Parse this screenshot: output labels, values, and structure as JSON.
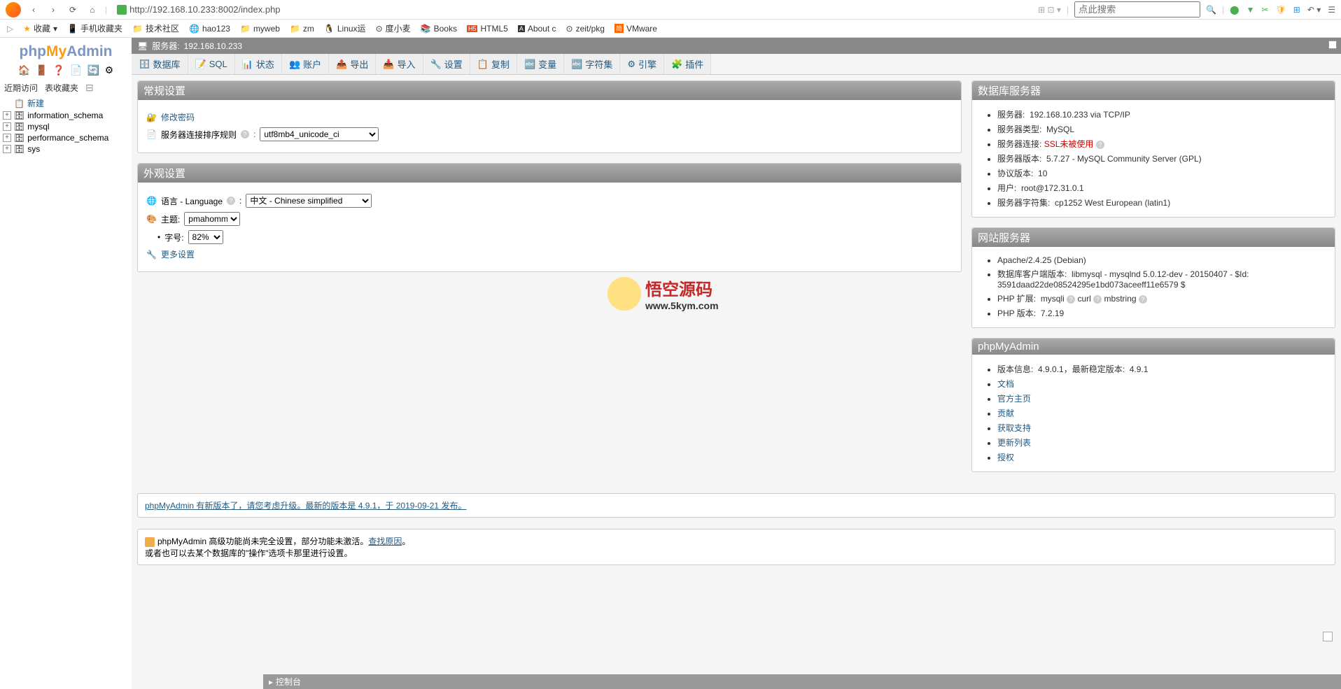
{
  "browser": {
    "url": "http://192.168.10.233:8002/index.php",
    "search_placeholder": "点此搜索"
  },
  "bookmarks": {
    "items": [
      {
        "label": "收藏"
      },
      {
        "label": "手机收藏夹"
      },
      {
        "label": "技术社区"
      },
      {
        "label": "hao123"
      },
      {
        "label": "myweb"
      },
      {
        "label": "zm"
      },
      {
        "label": "Linux运"
      },
      {
        "label": "度小麦"
      },
      {
        "label": "Books"
      },
      {
        "label": "HTML5"
      },
      {
        "label": "About c"
      },
      {
        "label": "zeit/pkg"
      },
      {
        "label": "VMware"
      }
    ]
  },
  "logo": {
    "php": "php",
    "my": "My",
    "admin": "Admin"
  },
  "sidebar": {
    "recent": "近期访问",
    "favorites": "表收藏夹",
    "new_link": "新建",
    "databases": [
      {
        "name": "information_schema"
      },
      {
        "name": "mysql"
      },
      {
        "name": "performance_schema"
      },
      {
        "name": "sys"
      }
    ]
  },
  "server_bar": {
    "label": "服务器:",
    "value": "192.168.10.233"
  },
  "tabs": [
    {
      "label": "数据库"
    },
    {
      "label": "SQL"
    },
    {
      "label": "状态"
    },
    {
      "label": "账户"
    },
    {
      "label": "导出"
    },
    {
      "label": "导入"
    },
    {
      "label": "设置"
    },
    {
      "label": "复制"
    },
    {
      "label": "变量"
    },
    {
      "label": "字符集"
    },
    {
      "label": "引擎"
    },
    {
      "label": "插件"
    }
  ],
  "general_settings": {
    "title": "常规设置",
    "change_password": "修改密码",
    "collation_label": "服务器连接排序规则",
    "collation_value": "utf8mb4_unicode_ci"
  },
  "appearance": {
    "title": "外观设置",
    "language_label": "语言 - Language",
    "language_value": "中文 - Chinese simplified",
    "theme_label": "主题:",
    "theme_value": "pmahomme",
    "fontsize_label": "字号:",
    "fontsize_value": "82%",
    "more_settings": "更多设置"
  },
  "db_server": {
    "title": "数据库服务器",
    "items": {
      "server_label": "服务器:",
      "server_val": "192.168.10.233 via TCP/IP",
      "type_label": "服务器类型:",
      "type_val": "MySQL",
      "conn_label": "服务器连接:",
      "conn_val": "SSL未被使用",
      "version_label": "服务器版本:",
      "version_val": "5.7.27 - MySQL Community Server (GPL)",
      "protocol_label": "协议版本:",
      "protocol_val": "10",
      "user_label": "用户:",
      "user_val": "root@172.31.0.1",
      "charset_label": "服务器字符集:",
      "charset_val": "cp1252 West European (latin1)"
    }
  },
  "web_server": {
    "title": "网站服务器",
    "apache": "Apache/2.4.25 (Debian)",
    "client_label": "数据库客户端版本:",
    "client_val": "libmysql - mysqlnd 5.0.12-dev - 20150407 - $Id: 3591daad22de08524295e1bd073aceeff11e6579 $",
    "php_ext_label": "PHP 扩展:",
    "php_ext1": "mysqli",
    "php_ext2": "curl",
    "php_ext3": "mbstring",
    "php_ver_label": "PHP 版本:",
    "php_ver_val": "7.2.19"
  },
  "pma": {
    "title": "phpMyAdmin",
    "version_label": "版本信息:",
    "version_val": "4.9.0.1，最新稳定版本:",
    "latest": "4.9.1",
    "links": {
      "docs": "文档",
      "home": "官方主页",
      "contribute": "贡献",
      "support": "获取支持",
      "changelog": "更新列表",
      "license": "授权"
    }
  },
  "notice1": "phpMyAdmin 有新版本了，请您考虑升级。最新的版本是 4.9.1，于 2019-09-21 发布。",
  "notice2": {
    "text1": "phpMyAdmin 高级功能尚未完全设置，部分功能未激活。",
    "link": "查找原因",
    "text2": "。",
    "text3": "或者也可以去某个数据库的\"操作\"选项卡那里进行设置。"
  },
  "console": "控制台",
  "watermark": {
    "title": "悟空源码",
    "url": "www.5kym.com"
  }
}
